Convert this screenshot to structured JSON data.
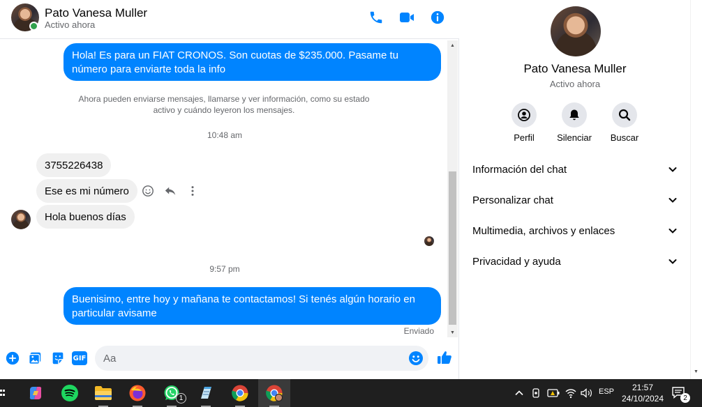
{
  "header": {
    "name": "Pato Vanesa Muller",
    "status": "Activo ahora"
  },
  "messages": [
    {
      "direction": "out",
      "text": "Hola! Es para un FIAT CRONOS. Son cuotas de $235.000. Pasame tu número para enviarte toda la info"
    },
    {
      "direction": "in",
      "text": "3755226438"
    },
    {
      "direction": "in",
      "text": "Ese es mi número"
    },
    {
      "direction": "in",
      "text": "Hola buenos días"
    },
    {
      "direction": "out",
      "text": "Buenisimo, entre hoy y mañana te contactamos! Si tenés algún horario en particular avisame"
    }
  ],
  "system_notice": "Ahora pueden enviarse mensajes, llamarse y ver información, como su estado activo y cuándo leyeron los mensajes.",
  "timestamps": [
    "10:48 am",
    "9:57 pm"
  ],
  "sent_status": "Enviado",
  "composer": {
    "placeholder": "Aa",
    "gif_label": "GIF"
  },
  "panel": {
    "name": "Pato Vanesa Muller",
    "status": "Activo ahora",
    "actions": [
      {
        "label": "Perfil",
        "icon": "profile-icon"
      },
      {
        "label": "Silenciar",
        "icon": "bell-icon"
      },
      {
        "label": "Buscar",
        "icon": "search-icon"
      }
    ],
    "sections": [
      "Información del chat",
      "Personalizar chat",
      "Multimedia, archivos y enlaces",
      "Privacidad y ayuda"
    ]
  },
  "taskbar": {
    "apps": [
      "copilot",
      "spotify",
      "file-explorer",
      "firefox",
      "whatsapp",
      "notepad",
      "chrome",
      "chrome-profile"
    ],
    "whatsapp_badge": "1",
    "language": "ESP",
    "time": "21:57",
    "date": "24/10/2024",
    "notifications": "2"
  },
  "colors": {
    "accent": "#0084ff",
    "online": "#31a24c"
  }
}
